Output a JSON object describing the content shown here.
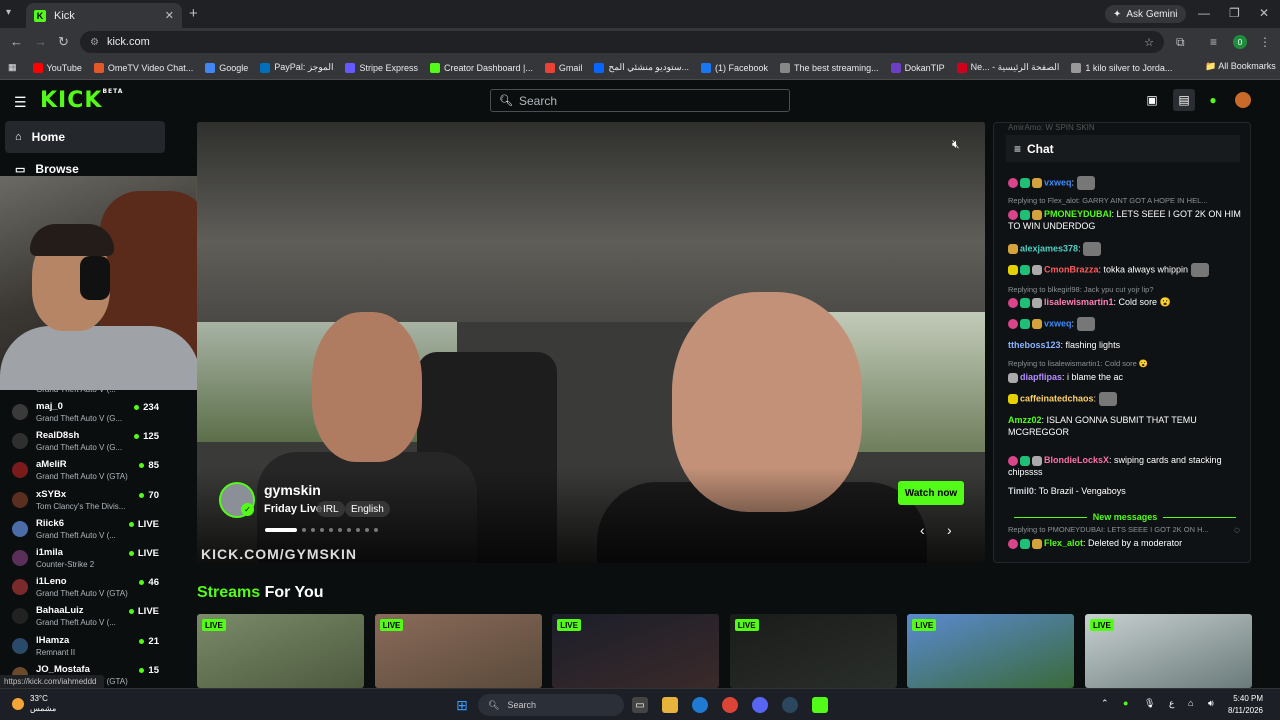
{
  "browser": {
    "tab_title": "Kick",
    "tab_icon": "K",
    "ask_gemini": "Ask Gemini",
    "url": "kick.com",
    "profile_initial": "0",
    "bookmarks": [
      {
        "label": "YouTube",
        "color": "#ff0000"
      },
      {
        "label": "OmeTV Video Chat...",
        "color": "#e2582a"
      },
      {
        "label": "Google",
        "color": "#4285f4"
      },
      {
        "label": "PayPal: الموجز",
        "color": "#0070ba"
      },
      {
        "label": "Stripe Express",
        "color": "#635bff"
      },
      {
        "label": "Creator Dashboard |...",
        "color": "#53fc18"
      },
      {
        "label": "Gmail",
        "color": "#ea4335"
      },
      {
        "label": "ستوديو منشئي المح...",
        "color": "#0866ff"
      },
      {
        "label": "(1) Facebook",
        "color": "#1877f2"
      },
      {
        "label": "The best streaming...",
        "color": "#888888"
      },
      {
        "label": "DokanTIP",
        "color": "#6c3fc4"
      },
      {
        "label": "Ne... - الصفحة الرئيسية",
        "color": "#d0021b"
      },
      {
        "label": "1 kilo silver to Jorda...",
        "color": "#999999"
      }
    ],
    "all_bookmarks": "All Bookmarks",
    "status_url": "https://kick.com/iahmeddd"
  },
  "header": {
    "logo": "KICK",
    "logo_badge": "BETA",
    "search_placeholder": "Search"
  },
  "sidebar": {
    "nav": [
      {
        "label": "Home"
      },
      {
        "label": "Browse"
      }
    ],
    "partial_top_game": "Grand Theft Auto V (...",
    "channels": [
      {
        "name": "maj_0",
        "game": "Grand Theft Auto V (G...",
        "viewers": "234",
        "avatar_color": "#3a3a3a"
      },
      {
        "name": "RealD8sh",
        "game": "Grand Theft Auto V (G...",
        "viewers": "125",
        "avatar_color": "#2f2f2f"
      },
      {
        "name": "aMeliR",
        "game": "Grand Theft Auto V (GTA)",
        "viewers": "85",
        "avatar_color": "#7a1b1b"
      },
      {
        "name": "xSYBx",
        "game": "Tom Clancy's The Divis...",
        "viewers": "70",
        "avatar_color": "#5a2f1f"
      },
      {
        "name": "Riick6",
        "game": "Grand Theft Auto V (...",
        "viewers": "LIVE",
        "avatar_color": "#4a6da8"
      },
      {
        "name": "i1mila",
        "game": "Counter-Strike 2",
        "viewers": "LIVE",
        "avatar_color": "#5a2f5a"
      },
      {
        "name": "i1Leno",
        "game": "Grand Theft Auto V (GTA)",
        "viewers": "46",
        "avatar_color": "#7a2a2a"
      },
      {
        "name": "BahaaLuiz",
        "game": "Grand Theft Auto V (...",
        "viewers": "LIVE",
        "avatar_color": "#222222"
      },
      {
        "name": "lHamza",
        "game": "Remnant II",
        "viewers": "21",
        "avatar_color": "#2a4a6a"
      },
      {
        "name": "JO_Mostafa",
        "game": "Grand Theft Auto V (GTA)",
        "viewers": "15",
        "avatar_color": "#6a4a2a"
      }
    ]
  },
  "hero": {
    "streamer": "gymskin",
    "title": "Friday Live",
    "tags": [
      "IRL",
      "English"
    ],
    "watch_now": "Watch now",
    "watermark": "KICK.COM/GYMSKIN",
    "slides_total": 10,
    "slide_active": 1
  },
  "chat": {
    "title": "Chat",
    "faded_top": "AmirAmo: W SPIN SKIN",
    "messages": [
      {
        "user": "vxweq",
        "color": "#3d8bff",
        "text": ":",
        "emote": true
      },
      {
        "reply": "Replying to Flex_alot: GARRY AINT GOT A HOPE IN HEL..."
      },
      {
        "user": "PMONEYDUBAI",
        "color": "#53fc18",
        "text": ": LETS SEEE I GOT 2K ON HIM TO WIN UNDERDOG"
      },
      {
        "user": "alexjames378",
        "color": "#4fd1c5",
        "text": ":",
        "emote": true
      },
      {
        "user": "CmonBrazza",
        "color": "#ff5c5c",
        "text": ": tokka always whippin",
        "emote": true
      },
      {
        "reply": "Replying to blkegirl98: Jack ypu cut yojr lip?"
      },
      {
        "user": "lisalewismartin1",
        "color": "#ff7eb6",
        "text": ": Cold sore 😮"
      },
      {
        "user": "vxweq",
        "color": "#3d8bff",
        "text": ":",
        "emote": true
      },
      {
        "user": "ttheboss123",
        "color": "#8ab4ff",
        "text": ": flashing lights"
      },
      {
        "reply": "Replying to lisalewismartin1: Cold sore 😮"
      },
      {
        "user": "diapflipas",
        "color": "#b58cff",
        "text": ": i blame the ac"
      },
      {
        "user": "caffeinatedchaos",
        "color": "#ffd166",
        "text": ":",
        "emote": true
      },
      {
        "user": "Amzz02",
        "color": "#53fc18",
        "text": ": ISLAN GONNA SUBMIT THAT TEMU MCGREGGOR"
      },
      {
        "user": "BlondieLocksX",
        "color": "#ff6fa8",
        "text": ": swiping cards and stacking chipssss"
      },
      {
        "user": "Timil0",
        "color": "#c9d1d9",
        "text": ": To Brazil - Vengaboys"
      },
      {
        "new_messages": "New messages"
      },
      {
        "reply": "Replying to PMONEYDUBAI: LETS SEEE I GOT 2K ON H..."
      },
      {
        "user": "Flex_alot",
        "color": "#53fc18",
        "text": ": Deleted by a moderator"
      }
    ]
  },
  "streams": {
    "title_a": "Streams",
    "title_b": "For You",
    "live_label": "LIVE",
    "cards": [
      {
        "colors": [
          "#7a8a6a",
          "#4e5a3e"
        ]
      },
      {
        "colors": [
          "#8a6a5a",
          "#5a4a3a"
        ]
      },
      {
        "colors": [
          "#1c1e2a",
          "#3a2a2a"
        ]
      },
      {
        "colors": [
          "#1a1c1a",
          "#2a2e2a"
        ]
      },
      {
        "colors": [
          "#5a8ad0",
          "#3a6a3a"
        ]
      },
      {
        "colors": [
          "#c8d0d0",
          "#6a7a7a"
        ]
      }
    ]
  },
  "taskbar": {
    "temp": "33°C",
    "condition": "مشمس",
    "search": "Search",
    "tray_lang": "ع",
    "time": "5:40 PM",
    "date": "8/11/2026"
  }
}
